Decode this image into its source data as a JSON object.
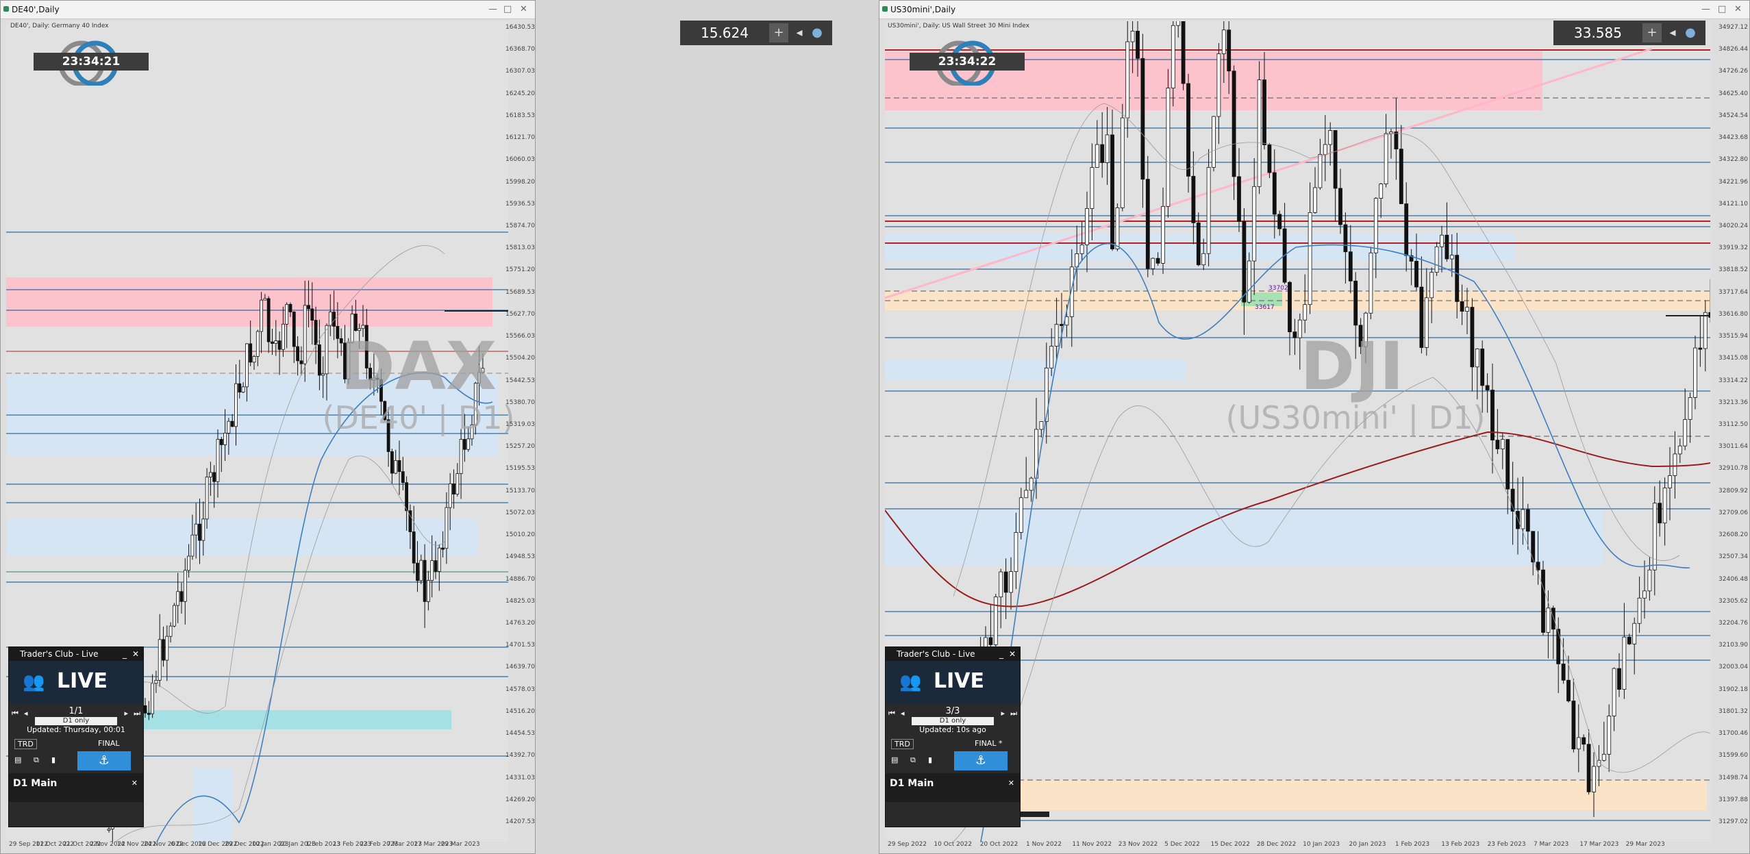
{
  "colors": {
    "resistance_zone": "#ffc0cb",
    "support_zone": "#d4e6f6",
    "hline_blue": "#2e6da4",
    "hline_red": "#b22222",
    "teal_zone": "#9ee0e6",
    "orange_zone": "#fde3c4",
    "ma_blue": "#3f7fbf",
    "ma_red": "#9b1c1c"
  },
  "left": {
    "window_title": "DE40',Daily",
    "subheader": "DE40', Daily:  Germany 40 Index",
    "price_badge": "15.624",
    "clock": "23:34:21",
    "watermark_title": "DAX",
    "watermark_sub": "(DE40' | D1)",
    "y_ticks": [
      "16430.53",
      "16368.70",
      "16307.03",
      "16245.20",
      "16183.53",
      "16121.70",
      "16060.03",
      "15998.20",
      "15936.53",
      "15874.70",
      "15813.03",
      "15751.20",
      "15689.53",
      "15627.70",
      "15566.03",
      "15504.20",
      "15442.53",
      "15380.70",
      "15319.03",
      "15257.20",
      "15195.53",
      "15133.70",
      "15072.03",
      "15010.20",
      "14948.53",
      "14886.70",
      "14825.03",
      "14763.20",
      "14701.53",
      "14639.70",
      "14578.03",
      "14516.20",
      "14454.53",
      "14392.70",
      "14331.03",
      "14269.20",
      "14207.53"
    ],
    "x_ticks": [
      "29 Sep 2022",
      "11 Oct 2022",
      "21 Oct 2022",
      "2 Nov 2022",
      "14 Nov 2022",
      "24 Nov 2022",
      "6 Dec 2022",
      "16 Dec 2022",
      "29 Dec 2022",
      "10 Jan 2023",
      "20 Jan 2023",
      "1 Feb 2023",
      "13 Feb 2023",
      "23 Feb 2023",
      "7 Mar 2023",
      "17 Mar 2023",
      "29 Mar 2023"
    ],
    "levels": [
      {
        "text": "15513",
        "color": "#b22222"
      },
      {
        "text": "15273",
        "color": "#2e6da4"
      },
      {
        "text": "14895",
        "color": "#2e8b57"
      },
      {
        "text": "14807",
        "color": "#2e6da4"
      }
    ],
    "panel": {
      "title": "Trader's Club - Live",
      "banner": "LIVE",
      "page": "1/1",
      "filter": "D1 only",
      "updated": "Updated: Thursday, 00:01",
      "trd": "TRD",
      "final": "FINAL",
      "main": "D1 Main"
    }
  },
  "right": {
    "window_title": "US30mini',Daily",
    "subheader": "US30mini', Daily:  US Wall Street 30 Mini Index",
    "price_badge": "33.585",
    "clock": "23:34:22",
    "watermark_title": "DJI",
    "watermark_sub": "(US30mini' | D1)",
    "y_ticks": [
      "34927.12",
      "34826.44",
      "34726.26",
      "34625.40",
      "34524.54",
      "34423.68",
      "34322.80",
      "34221.96",
      "34121.10",
      "34020.24",
      "33919.32",
      "33818.52",
      "33717.64",
      "33616.80",
      "33515.94",
      "33415.08",
      "33314.22",
      "33213.36",
      "33112.50",
      "33011.64",
      "32910.78",
      "32809.92",
      "32709.06",
      "32608.20",
      "32507.34",
      "32406.48",
      "32305.62",
      "32204.76",
      "32103.90",
      "32003.04",
      "31902.18",
      "31801.32",
      "31700.46",
      "31599.60",
      "31498.74",
      "31397.88",
      "31297.02"
    ],
    "x_ticks": [
      "29 Sep 2022",
      "10 Oct 2022",
      "20 Oct 2022",
      "1 Nov 2022",
      "11 Nov 2022",
      "23 Nov 2022",
      "5 Dec 2022",
      "15 Dec 2022",
      "28 Dec 2022",
      "10 Jan 2023",
      "20 Jan 2023",
      "1 Feb 2023",
      "13 Feb 2023",
      "23 Feb 2023",
      "7 Mar 2023",
      "17 Mar 2023",
      "29 Mar 2023"
    ],
    "levels": [
      {
        "text": "34600",
        "color": "#111111"
      },
      {
        "text": "34530",
        "color": "#111111"
      },
      {
        "text": "34447",
        "color": "#2e6da4"
      },
      {
        "text": "34172",
        "color": "#2e6da4"
      },
      {
        "text": "34018",
        "color": "#b22222"
      },
      {
        "text": "33886",
        "color": "#b22222"
      },
      {
        "text": "33825",
        "color": "#2e6da4"
      },
      {
        "text": "33768",
        "color": "#2e6da4"
      },
      {
        "text": "33479",
        "color": "#2e6da4"
      },
      {
        "text": "33380",
        "color": "#2e6da4"
      },
      {
        "text": "33236",
        "color": "#2e6da4"
      },
      {
        "text": "33030",
        "color": "#2e6da4"
      },
      {
        "text": "32801",
        "color": "#2e6da4"
      },
      {
        "text": "32681",
        "color": "#2e6da4"
      },
      {
        "text": "32214",
        "color": "#2e6da4"
      },
      {
        "text": "32099",
        "color": "#2e6da4"
      },
      {
        "text": "31988",
        "color": "#2e6da4"
      },
      {
        "text": "31441",
        "color": "#6a0dad"
      },
      {
        "text": "31262",
        "color": "#2e6da4"
      }
    ],
    "inline_labels": [
      "33702",
      "33617"
    ],
    "panel": {
      "title": "Trader's Club - Live",
      "banner": "LIVE",
      "page": "3/3",
      "filter": "D1 only",
      "updated": "Updated: 10s ago",
      "trd": "TRD",
      "final": "FINAL *",
      "main": "D1 Main"
    }
  }
}
